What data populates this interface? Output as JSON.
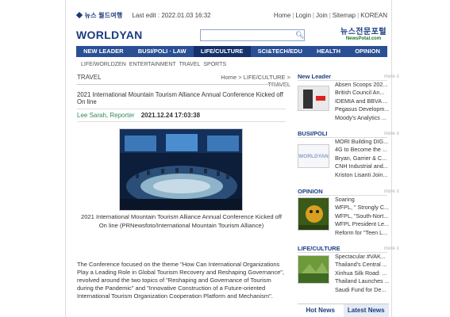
{
  "top": {
    "logo": "◆ 뉴스 월드여행",
    "last_edit": "Last edit : 2022.01.03 16:32",
    "links": [
      "Home",
      "Login",
      "Join",
      "Sitemap",
      "KOREAN"
    ]
  },
  "brand": {
    "name": "WORLDYAN"
  },
  "search": {
    "placeholder": ""
  },
  "partner": {
    "line1": "뉴스전문포털",
    "line2": "NewsPotal.com"
  },
  "nav": {
    "items": [
      "NEW LEADER",
      "BUSI/POLI · LAW",
      "LIFE/CULTURE",
      "SCI&TECH/EDU",
      "HEALTH",
      "OPINION"
    ],
    "active_index": 2
  },
  "subnav": [
    "LIFE/WORLDZEN",
    "ENTERTAINMENT",
    "TRAVEL",
    "SPORTS"
  ],
  "article": {
    "section": "TRAVEL",
    "breadcrumb": "Home > LIFE/CULTURE > TRAVEL",
    "headline": "2021 International Mountain Tourism Alliance Annual Conference Kicked off On line",
    "author": "Lee Sarah, Reporter",
    "date": "2021.12.24 17:03:38",
    "caption": "2021 International Mountain Tourism Alliance Annual Conference Kicked off On line (PRNewsfoto/International Mountain Tourism Alliance)",
    "body": "The Conference focused on the theme \"How Can International Organizations Play a Leading Role in Global Tourism Recovery and Reshaping Governance\", revolved around the two topics of \"Reshaping and Governance of Tourism during the Pandemic\" and \"Innovative Construction of a Future-oriented International Tourism Organization Cooperation Platform and Mechanism\"."
  },
  "sidebar": {
    "sections": [
      {
        "title": "New Leader",
        "items": [
          "Absen Scoops 202...",
          "British Council An...",
          "IDEMIA and BBVA ...",
          "Pegasus Developm...",
          "Moody's Analytics ..."
        ]
      },
      {
        "title": "BUSI/POLI",
        "thumb_text": "WORLDYAN",
        "items": [
          "MORI Building DIG...",
          "4G to Become the ...",
          "Bryan, Garrier & C...",
          "CNH Industrial and...",
          "Kriston Lisanti Join..."
        ]
      },
      {
        "title": "OPINION",
        "items": [
          "Soaring",
          "WFPL, \" Strongly C...",
          "WFPL, \"South-Nort...",
          "WFPL President Le...",
          "Reform for \"Teen L..."
        ]
      },
      {
        "title": "LIFE/CULTURE",
        "items": [
          "Spectacular #VAK...",
          "Thailand's Central ...",
          "Xinhua Silk Road: ...",
          "Thailand Launches ...",
          "Saudi Fund for De..."
        ]
      }
    ],
    "more_label": "more ≡",
    "tabs": [
      "Hot News",
      "Latest News"
    ],
    "active_tab": 1
  }
}
